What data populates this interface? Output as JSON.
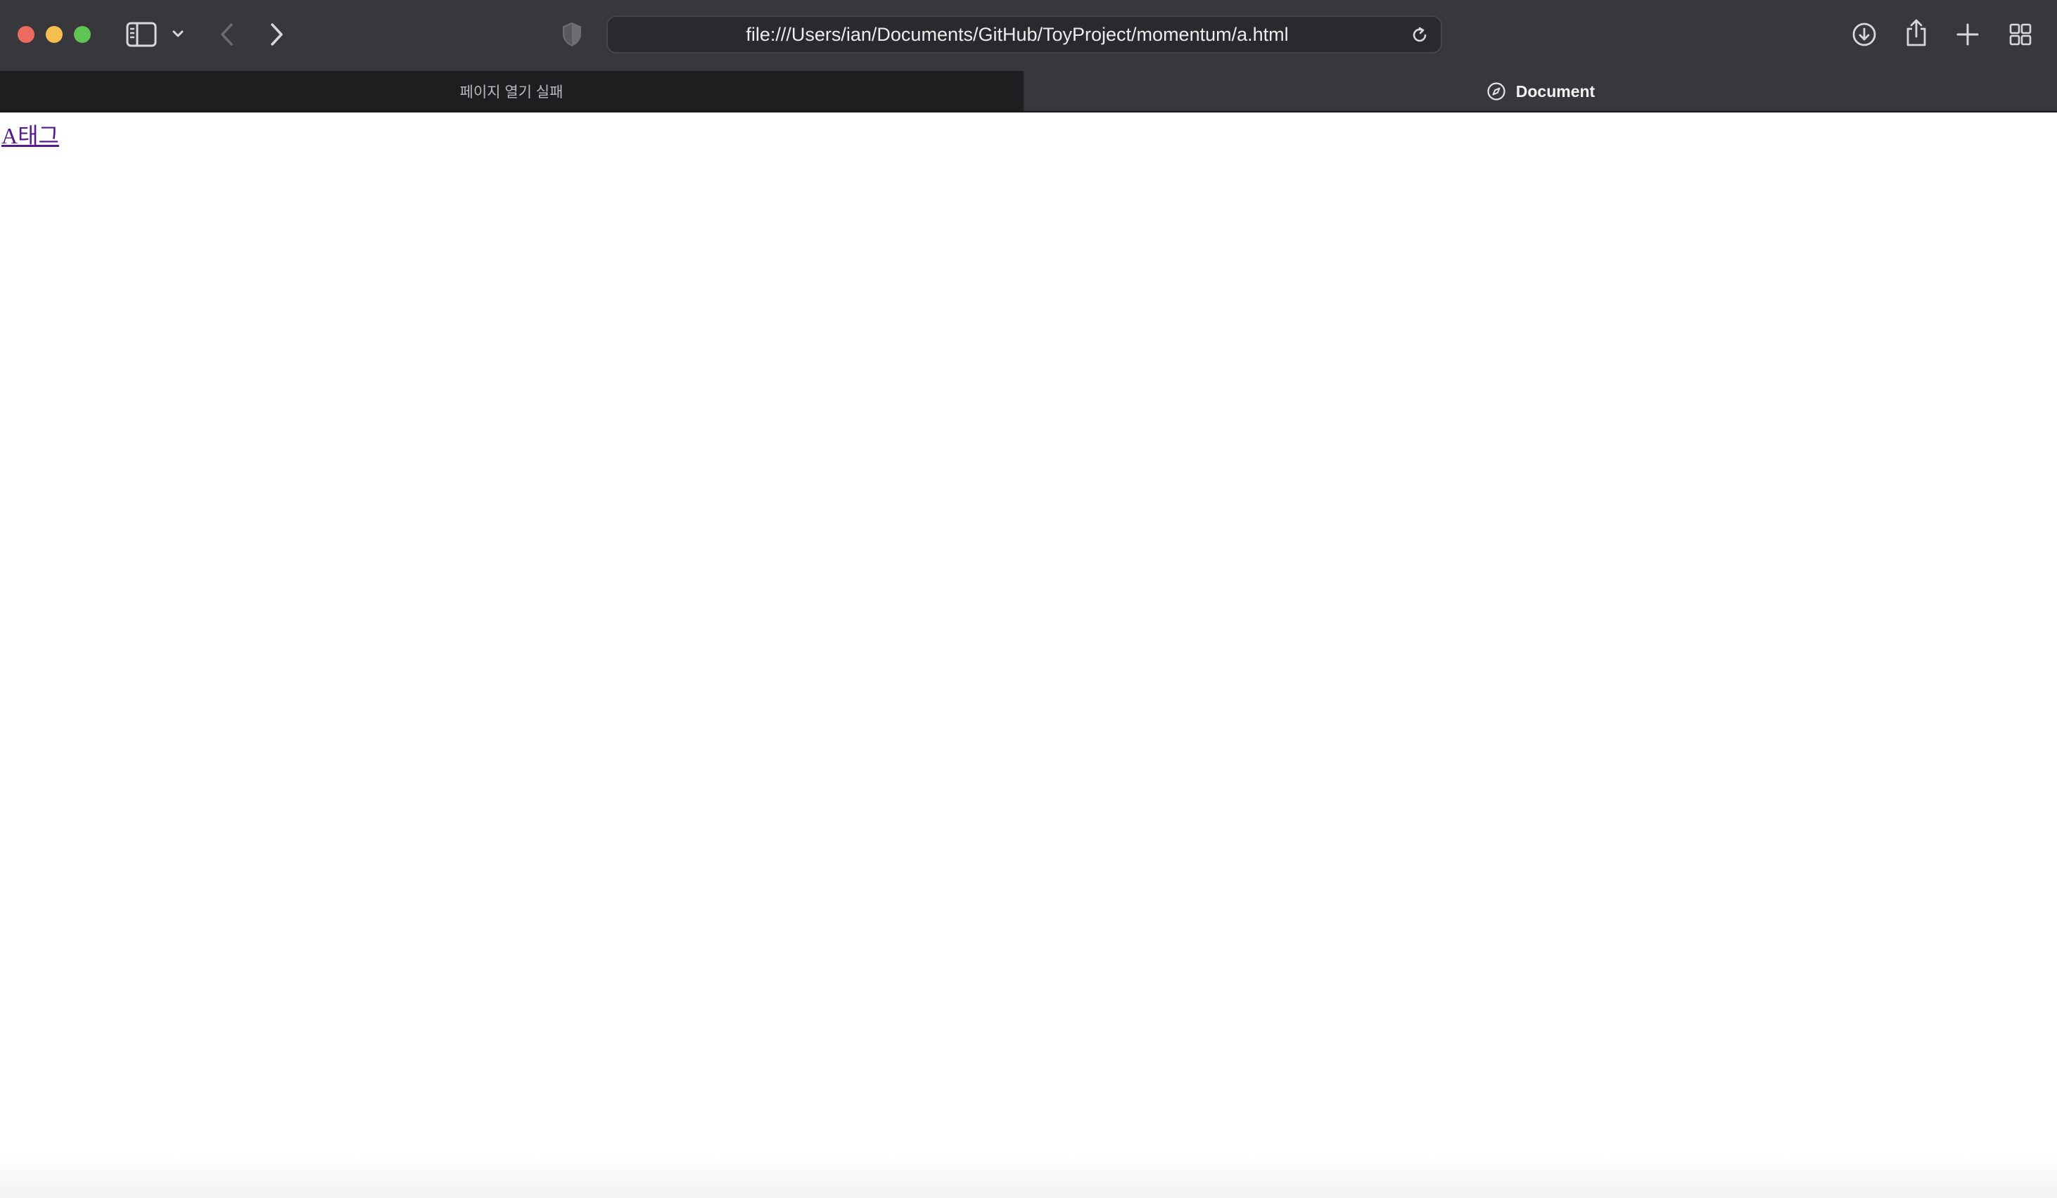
{
  "toolbar": {
    "traffic_lights": [
      {
        "name": "close",
        "color": "#ed6a5e"
      },
      {
        "name": "minimize",
        "color": "#f5bf4f"
      },
      {
        "name": "zoom",
        "color": "#61c554"
      }
    ],
    "icons": {
      "sidebar": "sidebar-icon",
      "sidebar_menu": "chevron-down-icon",
      "back": "chevron-left-icon",
      "forward": "chevron-right-icon",
      "privacy": "shield-icon",
      "reload": "reload-icon",
      "downloads": "download-icon",
      "share": "share-icon",
      "new_tab": "plus-icon",
      "tab_overview": "grid-icon"
    },
    "address": "file:///Users/ian/Documents/GitHub/ToyProject/momentum/a.html"
  },
  "tabs": [
    {
      "label": "페이지 열기 실패",
      "active": false
    },
    {
      "label": "Document",
      "active": true,
      "icon": "compass-icon"
    }
  ],
  "page": {
    "link_text": "A태그",
    "link_color": "#551a8b"
  }
}
